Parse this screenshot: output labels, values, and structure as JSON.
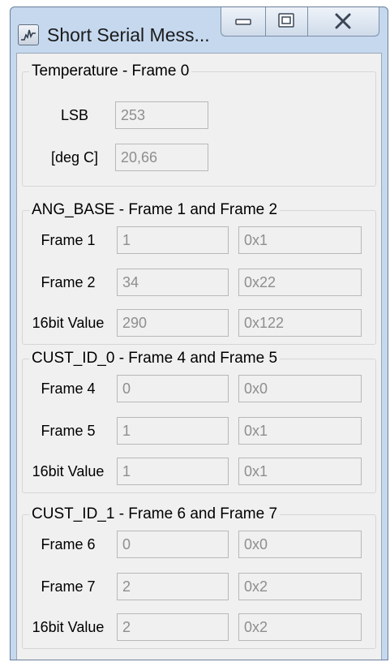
{
  "window": {
    "title": "Short Serial Mess...",
    "icon": "app-wave-icon"
  },
  "temperature": {
    "legend": "Temperature - Frame 0",
    "rows": [
      {
        "label": "LSB",
        "value": "253"
      },
      {
        "label": "[deg C]",
        "value": "20,66"
      }
    ]
  },
  "ang_base": {
    "legend": "ANG_BASE - Frame 1 and Frame 2",
    "rows": [
      {
        "label": "Frame 1",
        "dec": "1",
        "hex": "0x1"
      },
      {
        "label": "Frame 2",
        "dec": "34",
        "hex": "0x22"
      },
      {
        "label": "16bit Value",
        "dec": "290",
        "hex": "0x122"
      }
    ]
  },
  "cust_id_0": {
    "legend": "CUST_ID_0 - Frame 4 and Frame 5",
    "rows": [
      {
        "label": "Frame 4",
        "dec": "0",
        "hex": "0x0"
      },
      {
        "label": "Frame 5",
        "dec": "1",
        "hex": "0x1"
      },
      {
        "label": "16bit Value",
        "dec": "1",
        "hex": "0x1"
      }
    ]
  },
  "cust_id_1": {
    "legend": "CUST_ID_1 - Frame 6 and Frame 7",
    "rows": [
      {
        "label": "Frame 6",
        "dec": "0",
        "hex": "0x0"
      },
      {
        "label": "Frame 7",
        "dec": "2",
        "hex": "0x2"
      },
      {
        "label": "16bit Value",
        "dec": "2",
        "hex": "0x2"
      }
    ]
  }
}
